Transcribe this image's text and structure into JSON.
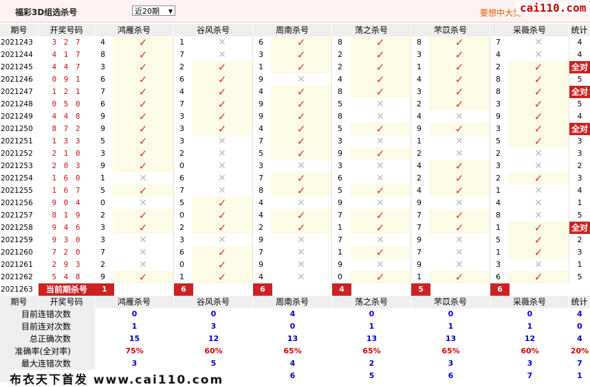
{
  "header": {
    "title": "福彩3D组选杀号",
    "period_select": "近20期",
    "promo": "要想中大奖",
    "brand": "cai110.com"
  },
  "columns": {
    "period": "期号",
    "draw": "开奖号码",
    "killers": [
      "鸿雁杀号",
      "谷风杀号",
      "周南杀号",
      "荡之杀号",
      "芣苡杀号",
      "采薇杀号"
    ],
    "total": "统计"
  },
  "rows": [
    {
      "p": "2021243",
      "d": "3 2 7",
      "k": [
        [
          "4",
          1
        ],
        [
          "1",
          0
        ],
        [
          "6",
          1
        ],
        [
          "8",
          1
        ],
        [
          "8",
          1
        ],
        [
          "7",
          0
        ]
      ],
      "t": "4"
    },
    {
      "p": "2021244",
      "d": "4 1 7",
      "k": [
        [
          "8",
          1
        ],
        [
          "7",
          0
        ],
        [
          "3",
          1
        ],
        [
          "2",
          1
        ],
        [
          "3",
          1
        ],
        [
          "4",
          0
        ]
      ],
      "t": "4"
    },
    {
      "p": "2021245",
      "d": "4 4 7",
      "k": [
        [
          "3",
          1
        ],
        [
          "2",
          1
        ],
        [
          "1",
          1
        ],
        [
          "2",
          1
        ],
        [
          "1",
          1
        ],
        [
          "2",
          1
        ]
      ],
      "t": "全对"
    },
    {
      "p": "2021246",
      "d": "0 9 1",
      "k": [
        [
          "6",
          1
        ],
        [
          "6",
          1
        ],
        [
          "9",
          0
        ],
        [
          "4",
          1
        ],
        [
          "4",
          1
        ],
        [
          "8",
          1
        ]
      ],
      "t": "5"
    },
    {
      "p": "2021247",
      "d": "1 2 1",
      "k": [
        [
          "7",
          1
        ],
        [
          "4",
          1
        ],
        [
          "4",
          1
        ],
        [
          "8",
          1
        ],
        [
          "3",
          1
        ],
        [
          "8",
          1
        ]
      ],
      "t": "全对"
    },
    {
      "p": "2021248",
      "d": "0 5 0",
      "k": [
        [
          "6",
          1
        ],
        [
          "7",
          1
        ],
        [
          "9",
          1
        ],
        [
          "5",
          0
        ],
        [
          "2",
          1
        ],
        [
          "3",
          1
        ]
      ],
      "t": "5"
    },
    {
      "p": "2021249",
      "d": "4 4 8",
      "k": [
        [
          "9",
          1
        ],
        [
          "3",
          1
        ],
        [
          "9",
          1
        ],
        [
          "8",
          0
        ],
        [
          "4",
          0
        ],
        [
          "9",
          1
        ]
      ],
      "t": "4"
    },
    {
      "p": "2021250",
      "d": "8 7 2",
      "k": [
        [
          "9",
          1
        ],
        [
          "3",
          1
        ],
        [
          "4",
          1
        ],
        [
          "5",
          1
        ],
        [
          "9",
          1
        ],
        [
          "3",
          1
        ]
      ],
      "t": "全对"
    },
    {
      "p": "2021251",
      "d": "1 3 3",
      "k": [
        [
          "5",
          1
        ],
        [
          "3",
          0
        ],
        [
          "7",
          1
        ],
        [
          "3",
          0
        ],
        [
          "1",
          0
        ],
        [
          "5",
          1
        ]
      ],
      "t": "3"
    },
    {
      "p": "2021252",
      "d": "2 1 0",
      "k": [
        [
          "3",
          1
        ],
        [
          "2",
          0
        ],
        [
          "5",
          1
        ],
        [
          "9",
          1
        ],
        [
          "2",
          0
        ],
        [
          "2",
          0
        ]
      ],
      "t": "3"
    },
    {
      "p": "2021253",
      "d": "2 0 3",
      "k": [
        [
          "9",
          1
        ],
        [
          "0",
          0
        ],
        [
          "3",
          0
        ],
        [
          "3",
          0
        ],
        [
          "4",
          1
        ],
        [
          "3",
          0
        ]
      ],
      "t": "2"
    },
    {
      "p": "2021254",
      "d": "1 6 0",
      "k": [
        [
          "1",
          0
        ],
        [
          "6",
          0
        ],
        [
          "7",
          1
        ],
        [
          "6",
          0
        ],
        [
          "2",
          1
        ],
        [
          "2",
          1
        ]
      ],
      "t": "3"
    },
    {
      "p": "2021255",
      "d": "1 6 7",
      "k": [
        [
          "5",
          1
        ],
        [
          "7",
          0
        ],
        [
          "8",
          1
        ],
        [
          "5",
          1
        ],
        [
          "4",
          1
        ],
        [
          "1",
          0
        ]
      ],
      "t": "4"
    },
    {
      "p": "2021256",
      "d": "9 0 4",
      "k": [
        [
          "0",
          0
        ],
        [
          "5",
          1
        ],
        [
          "4",
          0
        ],
        [
          "9",
          0
        ],
        [
          "9",
          0
        ],
        [
          "4",
          0
        ]
      ],
      "t": "1"
    },
    {
      "p": "2021257",
      "d": "8 1 9",
      "k": [
        [
          "2",
          1
        ],
        [
          "0",
          1
        ],
        [
          "4",
          1
        ],
        [
          "7",
          1
        ],
        [
          "7",
          1
        ],
        [
          "8",
          0
        ]
      ],
      "t": "5"
    },
    {
      "p": "2021258",
      "d": "9 4 6",
      "k": [
        [
          "3",
          1
        ],
        [
          "2",
          1
        ],
        [
          "2",
          1
        ],
        [
          "1",
          1
        ],
        [
          "7",
          1
        ],
        [
          "1",
          1
        ]
      ],
      "t": "全对"
    },
    {
      "p": "2021259",
      "d": "9 3 0",
      "k": [
        [
          "3",
          0
        ],
        [
          "3",
          0
        ],
        [
          "9",
          0
        ],
        [
          "7",
          0
        ],
        [
          "9",
          0
        ],
        [
          "5",
          1
        ]
      ],
      "t": "2"
    },
    {
      "p": "2021260",
      "d": "7 2 0",
      "k": [
        [
          "7",
          0
        ],
        [
          "6",
          1
        ],
        [
          "7",
          0
        ],
        [
          "1",
          1
        ],
        [
          "7",
          0
        ],
        [
          "1",
          1
        ]
      ],
      "t": "3"
    },
    {
      "p": "2021261",
      "d": "2 9 3",
      "k": [
        [
          "2",
          0
        ],
        [
          "0",
          1
        ],
        [
          "9",
          0
        ],
        [
          "9",
          0
        ],
        [
          "9",
          0
        ],
        [
          "3",
          0
        ]
      ],
      "t": "1"
    },
    {
      "p": "2021262",
      "d": "5 4 8",
      "k": [
        [
          "9",
          1
        ],
        [
          "1",
          1
        ],
        [
          "4",
          0
        ],
        [
          "0",
          1
        ],
        [
          "1",
          1
        ],
        [
          "6",
          1
        ]
      ],
      "t": "5"
    }
  ],
  "current": {
    "period": "2021263",
    "label": "当前期杀号",
    "values": [
      "1",
      "6",
      "6",
      "4",
      "5",
      "6"
    ]
  },
  "stats": [
    {
      "label": "目前连错次数",
      "values": [
        "0",
        "0",
        "4",
        "0",
        "0",
        "0"
      ],
      "total": "4",
      "red": false
    },
    {
      "label": "目前连对次数",
      "values": [
        "1",
        "3",
        "0",
        "1",
        "1",
        "1"
      ],
      "total": "0",
      "red": false
    },
    {
      "label": "总正确次数",
      "values": [
        "15",
        "12",
        "13",
        "13",
        "13",
        "12"
      ],
      "total": "4",
      "red": false
    },
    {
      "label": "准确率(全对率)",
      "values": [
        "75%",
        "60%",
        "65%",
        "65%",
        "65%",
        "60%"
      ],
      "total": "20%",
      "red": true
    },
    {
      "label": "最大连错次数",
      "values": [
        "3",
        "5",
        "4",
        "2",
        "3",
        "3"
      ],
      "total": "7",
      "red": false
    },
    {
      "label": "",
      "values": [
        "",
        "6",
        "6",
        "5",
        "6",
        "7"
      ],
      "total": "1",
      "red": false
    }
  ],
  "footer": "布衣天下首发 www.cai110.com"
}
